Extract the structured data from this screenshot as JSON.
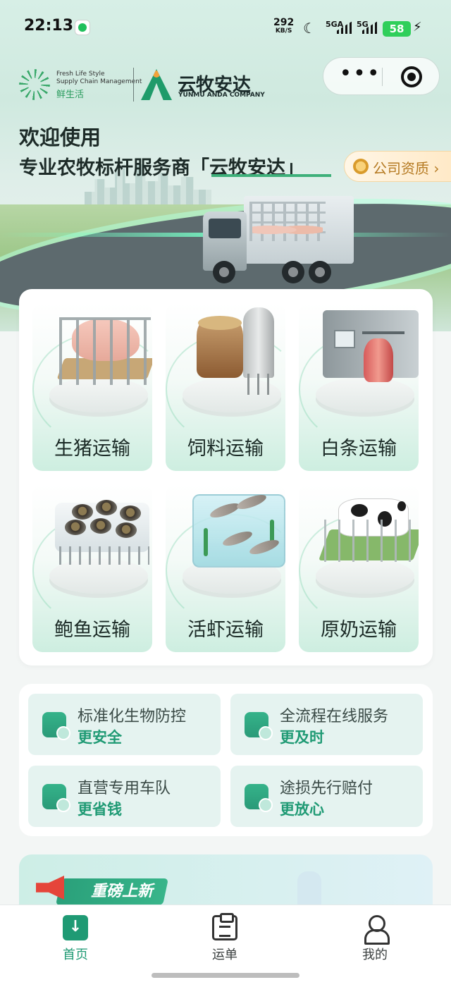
{
  "status_bar": {
    "time": "22:13",
    "speed_value": "292",
    "speed_unit": "KB/S",
    "sim1_label": "5GA",
    "sim2_label": "5G",
    "battery": "58"
  },
  "brand": {
    "partner_en_line1": "Fresh Life Style",
    "partner_en_line2": "Supply Chain Management",
    "partner_cn": "鲜生活",
    "company_cn": "云牧安达",
    "company_en": "YUNMU ANDA COMPANY"
  },
  "capsule": {
    "more_label": "•••"
  },
  "hero": {
    "welcome": "欢迎使用",
    "slogan": "专业农牧标杆服务商「云牧安达」",
    "qualification_button": "公司资质",
    "qualification_arrow": "›"
  },
  "services": [
    {
      "label": "生猪运输",
      "icon": "pig-icon"
    },
    {
      "label": "饲料运输",
      "icon": "feed-icon"
    },
    {
      "label": "白条运输",
      "icon": "carcass-icon"
    },
    {
      "label": "鲍鱼运输",
      "icon": "abalone-icon"
    },
    {
      "label": "活虾运输",
      "icon": "shrimp-icon"
    },
    {
      "label": "原奶运输",
      "icon": "cow-icon"
    }
  ],
  "features": [
    {
      "title": "标准化生物防控",
      "highlight": "更安全",
      "icon": "shield-icon"
    },
    {
      "title": "全流程在线服务",
      "highlight": "更及时",
      "icon": "heart-hand-icon"
    },
    {
      "title": "直营专用车队",
      "highlight": "更省钱",
      "icon": "money-bag-icon"
    },
    {
      "title": "途损先行赔付",
      "highlight": "更放心",
      "icon": "box-heart-icon"
    }
  ],
  "promo": {
    "title": "重磅上新"
  },
  "tabs": [
    {
      "label": "首页",
      "active": true
    },
    {
      "label": "运单",
      "active": false
    },
    {
      "label": "我的",
      "active": false
    }
  ],
  "colors": {
    "brand_green": "#1f9a74",
    "accent_gold": "#b57a22",
    "battery_green": "#2fcf5a"
  }
}
